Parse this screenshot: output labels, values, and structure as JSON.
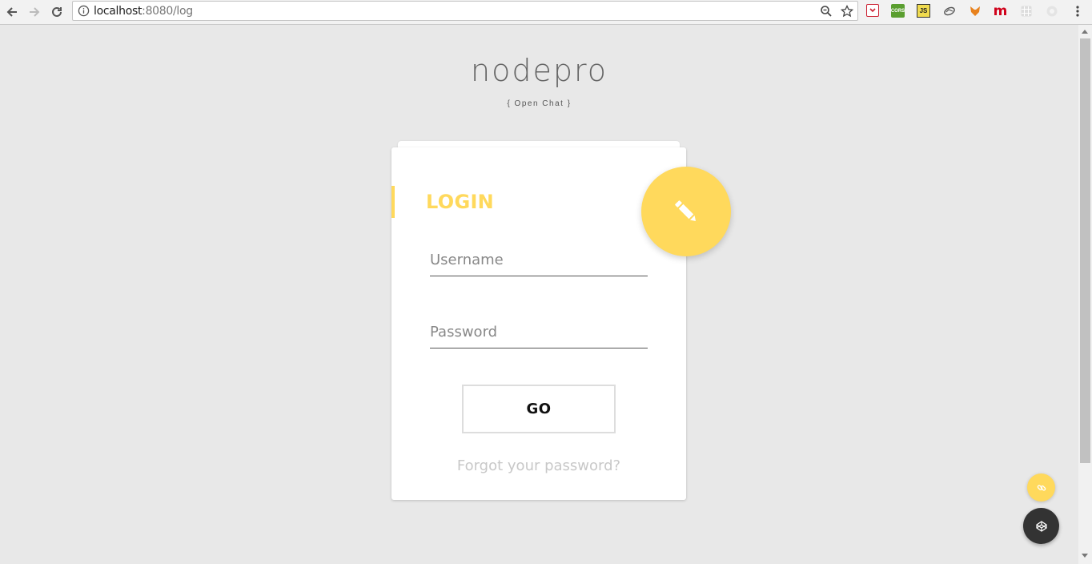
{
  "browser": {
    "url_host": "localhost",
    "url_path": ":8080/log",
    "extensions": {
      "cors_label": "CORS",
      "js_label": "JS",
      "m_label": "m"
    }
  },
  "brand": {
    "title": "nodepro",
    "subtitle": "{ Open Chat }"
  },
  "login": {
    "title": "LOGIN",
    "username_placeholder": "Username",
    "password_placeholder": "Password",
    "go_label": "GO",
    "forgot_label": "Forgot your password?"
  },
  "colors": {
    "accent": "#ffd95c",
    "background": "#e8e8e8",
    "dark_button": "#333333"
  },
  "icons": {
    "fab": "pencil-icon",
    "float_yellow": "link-icon",
    "float_dark": "codepen-icon"
  }
}
